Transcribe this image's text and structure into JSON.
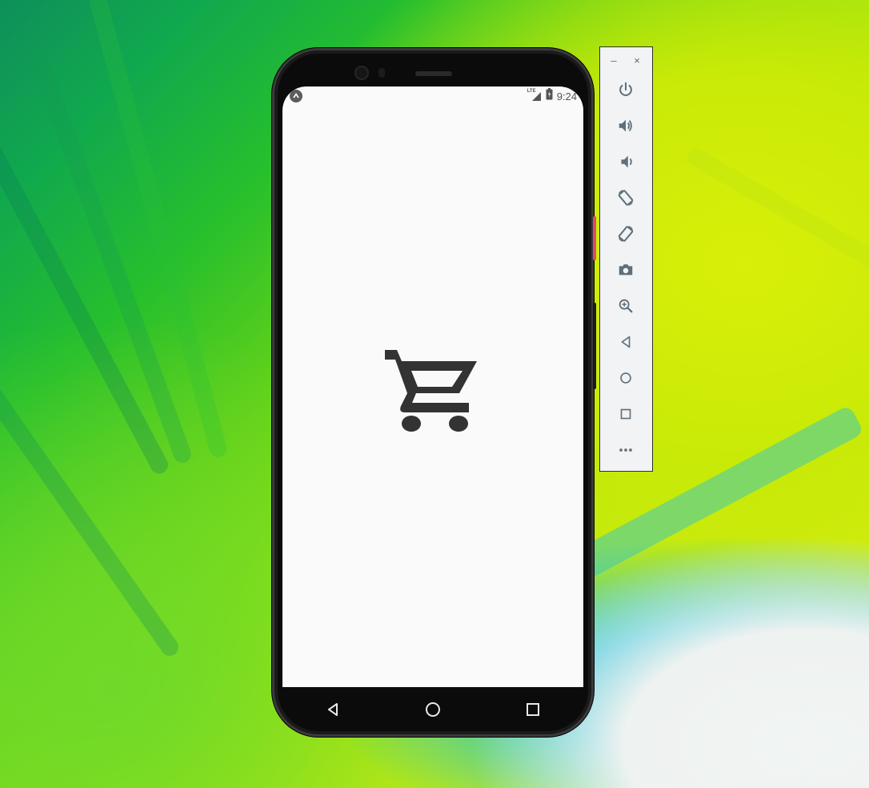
{
  "status_bar": {
    "network": "LTE",
    "time": "9:24"
  },
  "app": {
    "center_icon": "shopping-cart-icon"
  },
  "nav_bar": {
    "buttons": [
      "back-icon",
      "home-icon",
      "recents-icon"
    ]
  },
  "toolbar": {
    "minimize_label": "–",
    "close_label": "×",
    "buttons": [
      "power-icon",
      "volume-up-icon",
      "volume-down-icon",
      "rotate-left-icon",
      "rotate-right-icon",
      "camera-icon",
      "zoom-icon",
      "back-icon",
      "home-icon",
      "overview-icon",
      "more-icon"
    ]
  },
  "colors": {
    "toolbar_icon": "#5f6f7a",
    "cart": "#333333",
    "screen_bg": "#fafafa",
    "phone_body": "#0b0b0b"
  }
}
